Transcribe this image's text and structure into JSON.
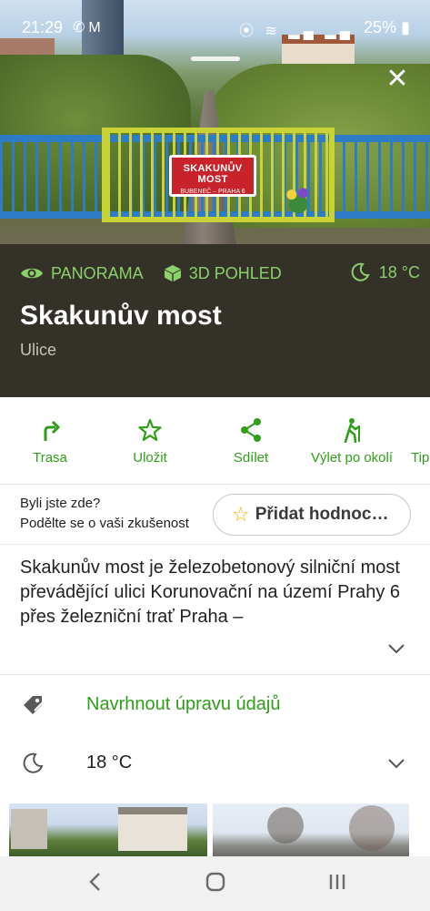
{
  "status_bar": {
    "time": "21:29",
    "left_icons": [
      "whatsapp-icon",
      "gmail-icon"
    ],
    "right_icons": [
      "location-icon",
      "wifi-icon",
      "signal-icon",
      "signal-icon"
    ],
    "battery": "25%"
  },
  "hero": {
    "sign_line1": "SKAKUNŮV MOST",
    "sign_line2": "BUBENEČ – PRAHA 6"
  },
  "info": {
    "chips": [
      "PANORAMA",
      "3D POHLED"
    ],
    "weather": "18 °C",
    "title": "Skakunův most",
    "type": "Ulice"
  },
  "actions": [
    {
      "label": "Trasa",
      "icon": "route-icon"
    },
    {
      "label": "Uložit",
      "icon": "star-icon"
    },
    {
      "label": "Sdílet",
      "icon": "share-icon"
    },
    {
      "label": "Výlet po okolí",
      "icon": "hiking-icon"
    },
    {
      "label": "Tip",
      "icon": "tip-icon"
    }
  ],
  "review": {
    "question1": "Byli jste zde?",
    "question2": "Podělte se o vaši zkušenost",
    "button": "Přidat hodnoc…"
  },
  "description": "Skakunův most je železobetonový silniční most převádějící ulici Korunovační na území Prahy 6 přes železniční trať Praha –",
  "rows": {
    "edit": "Navrhnout úpravu údajů",
    "weather": "18 °C"
  },
  "colors": {
    "accent_green": "#2f9e19",
    "panel_bg": "#333128",
    "chip_green": "#8bd06a"
  }
}
